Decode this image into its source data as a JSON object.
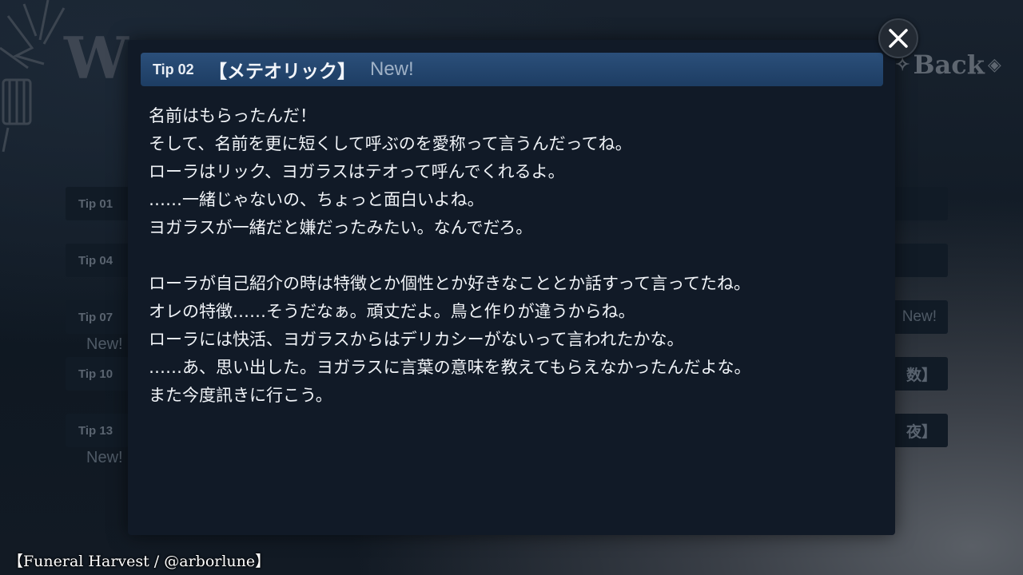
{
  "background": {
    "title_fragment": "W",
    "back_label": "Back",
    "tips": [
      {
        "label": "Tip 01",
        "right": "",
        "new": ""
      },
      {
        "label": "Tip 04",
        "right": "",
        "new": ""
      },
      {
        "label": "Tip 07",
        "right": "New!",
        "new": "New!"
      },
      {
        "label": "Tip 10",
        "right": "数】",
        "new": ""
      },
      {
        "label": "Tip 13",
        "right": "夜】",
        "new": "New!"
      }
    ]
  },
  "modal": {
    "tip_number": "Tip 02",
    "tip_title": "【メテオリック】",
    "new_badge": "New!",
    "lines": [
      "名前はもらったんだ！",
      "そして、名前を更に短くして呼ぶのを愛称って言うんだってね。",
      "ローラはリック、ヨガラスはテオって呼んでくれるよ。",
      "……一緒じゃないの、ちょっと面白いよね。",
      "ヨガラスが一緒だと嫌だったみたい。なんでだろ。",
      "",
      "ローラが自己紹介の時は特徴とか個性とか好きなこととか話すって言ってたね。",
      "オレの特徴……そうだなぁ。頑丈だよ。鳥と作りが違うからね。",
      "ローラには快活、ヨガラスからはデリカシーがないって言われたかな。",
      "……あ、思い出した。ヨガラスに言葉の意味を教えてもらえなかったんだよな。",
      "また今度訊きに行こう。"
    ]
  },
  "close_icon": "close-icon",
  "credit": "【Funeral Harvest / @arborlune】",
  "colors": {
    "header_bg": "#2b4f7a",
    "modal_bg": "#111a27",
    "new_badge": "#9fb1c6"
  }
}
